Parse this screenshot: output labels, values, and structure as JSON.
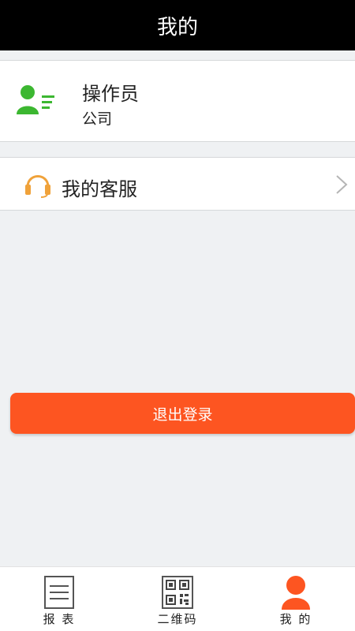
{
  "header": {
    "title": "我的"
  },
  "profile": {
    "name": "操作员",
    "company": "公司",
    "icon": "user-list-icon",
    "icon_color": "#3cb731"
  },
  "menu": {
    "customer_service": {
      "label": "我的客服",
      "icon": "headset-icon",
      "icon_color": "#f0a23a"
    }
  },
  "logout": {
    "label": "退出登录",
    "color": "#fd5521"
  },
  "tabbar": {
    "tabs": [
      {
        "label": "报 表",
        "icon": "report-list-icon"
      },
      {
        "label": "二维码",
        "icon": "qr-code-icon"
      },
      {
        "label": "我 的",
        "icon": "user-icon",
        "active_color": "#fd5521"
      }
    ]
  }
}
